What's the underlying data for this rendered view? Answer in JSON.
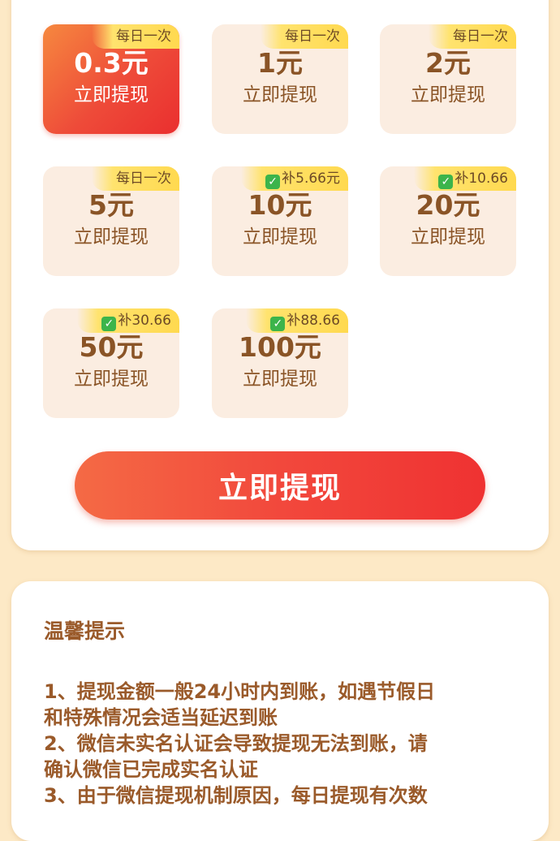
{
  "options": [
    {
      "amount": "0.3元",
      "action": "立即提现",
      "tag": "每日一次",
      "tag_check": false,
      "selected": true
    },
    {
      "amount": "1元",
      "action": "立即提现",
      "tag": "每日一次",
      "tag_check": false,
      "selected": false
    },
    {
      "amount": "2元",
      "action": "立即提现",
      "tag": "每日一次",
      "tag_check": false,
      "selected": false
    },
    {
      "amount": "5元",
      "action": "立即提现",
      "tag": "每日一次",
      "tag_check": false,
      "selected": false
    },
    {
      "amount": "10元",
      "action": "立即提现",
      "tag": "补5.66元",
      "tag_check": true,
      "selected": false
    },
    {
      "amount": "20元",
      "action": "立即提现",
      "tag": "补10.66",
      "tag_check": true,
      "selected": false
    },
    {
      "amount": "50元",
      "action": "立即提现",
      "tag": "补30.66",
      "tag_check": true,
      "selected": false
    },
    {
      "amount": "100元",
      "action": "立即提现",
      "tag": "补88.66",
      "tag_check": true,
      "selected": false
    }
  ],
  "withdraw_button": {
    "label": "立即提现"
  },
  "tips": {
    "title": "温馨提示",
    "lines": [
      "1、提现金额一般24小时内到账，如遇节假日",
      "和特殊情况会适当延迟到账",
      "2、微信未实名认证会导致提现无法到账，请",
      "确认微信已完成实名认证",
      "3、由于微信提现机制原因，每日提现有次数"
    ]
  },
  "colors": {
    "page_bg": "#fde9c6",
    "accent": "#ef3b35",
    "text_brown": "#8a5426",
    "tag_yellow": "#ffdd57",
    "check_green": "#3cb44b"
  }
}
